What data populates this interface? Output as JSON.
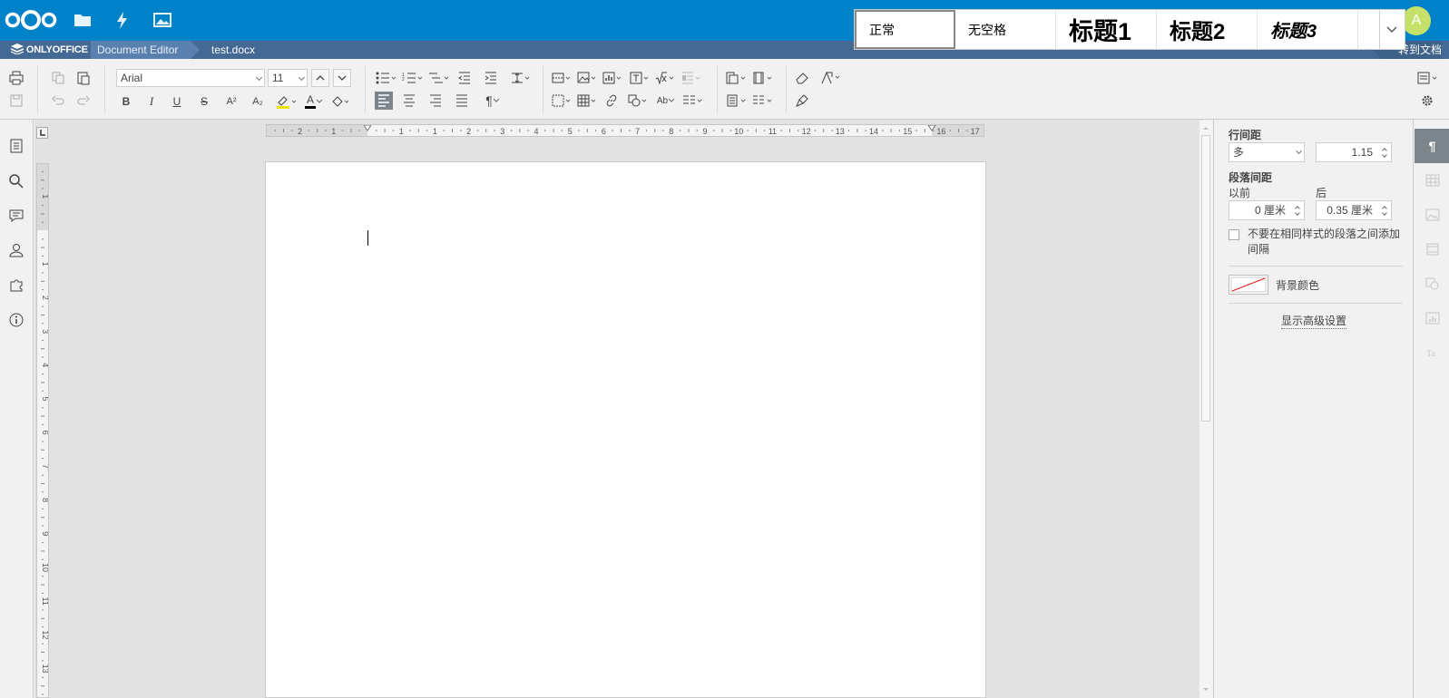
{
  "nextcloud": {
    "apps": [
      "files-icon",
      "activity-icon",
      "gallery-icon"
    ],
    "avatar_letter": "A"
  },
  "titlebar": {
    "brand": "ONLYOFFICE",
    "editor": "Document Editor",
    "file_name": "test.docx",
    "goto_docs": "转到文档"
  },
  "toolbar": {
    "font_name": "Arial",
    "font_size": "11",
    "bold": "B",
    "italic": "I",
    "underline": "U",
    "strike": "S",
    "superscript": "A²",
    "subscript": "A₂",
    "font_color": "A",
    "paragraph_mark": "¶"
  },
  "styles": {
    "items": [
      "正常",
      "无空格",
      "标题1",
      "标题2",
      "标题3"
    ],
    "selected": "正常"
  },
  "ruler": {
    "h_labels": [
      "2",
      "1",
      "1",
      "1",
      "2",
      "3",
      "4",
      "5",
      "6",
      "7",
      "8",
      "9",
      "10",
      "11",
      "12",
      "13",
      "14",
      "15",
      "16",
      "17"
    ],
    "v_labels": [
      "1",
      "1",
      "2",
      "3",
      "4",
      "5",
      "6",
      "7",
      "8",
      "9",
      "10",
      "11",
      "12",
      "13"
    ]
  },
  "paragraph_settings": {
    "line_spacing_label": "行间距",
    "line_spacing_mode": "多",
    "line_spacing_value": "1.15",
    "spacing_label": "段落间距",
    "before_label": "以前",
    "after_label": "后",
    "before_value": "0 厘米",
    "after_value": "0.35 厘米",
    "no_space_label_1": "不要在相同样式的段落之间添加",
    "no_space_label_2": "间隔",
    "bg_color_label": "背景颜色",
    "advanced_link": "显示高级设置"
  },
  "colors": {
    "nextcloud_blue": "#0082c9",
    "onlyoffice_bar": "#446995",
    "avatar": "#c5e16a",
    "active_tab": "#7d858c"
  }
}
